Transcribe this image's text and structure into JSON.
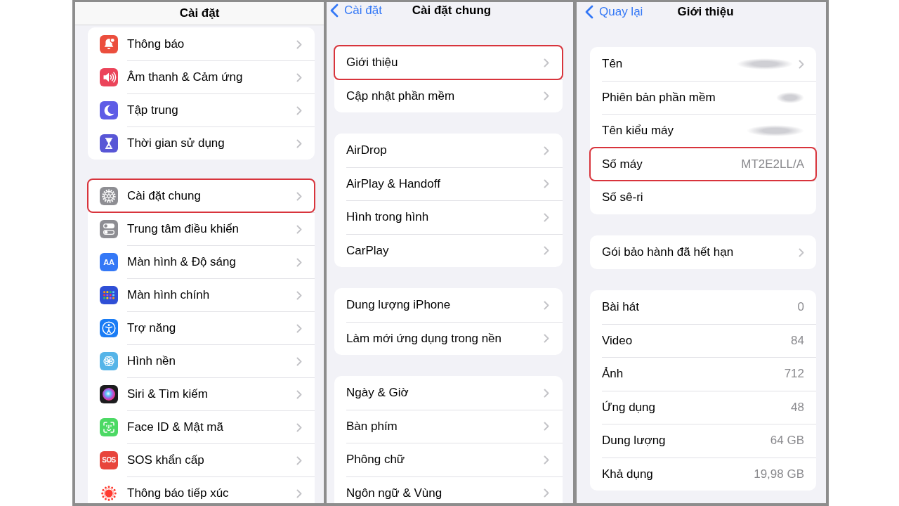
{
  "settings_screen": {
    "title": "Cài đặt",
    "scrolled": true,
    "groups": [
      {
        "rows": [
          {
            "label": "Thông báo",
            "color": "#eb4e3d",
            "chevron": true,
            "highlighted": false
          },
          {
            "label": "Âm thanh & Cảm ứng",
            "color": "#eb445a",
            "chevron": true,
            "highlighted": false
          },
          {
            "label": "Tập trung",
            "color": "#5e5ce6",
            "chevron": true,
            "highlighted": false
          },
          {
            "label": "Thời gian sử dụng",
            "color": "#5856d6",
            "chevron": true,
            "highlighted": false
          }
        ]
      },
      {
        "rows": [
          {
            "label": "Cài đặt chung",
            "color": "#8e8e93",
            "chevron": true,
            "highlighted": true
          },
          {
            "label": "Trung tâm điều khiển",
            "color": "#8e8e93",
            "chevron": true,
            "highlighted": false
          },
          {
            "label": "Màn hình & Độ sáng",
            "color": "#3478f6",
            "icon_text": "AA",
            "chevron": true,
            "highlighted": false
          },
          {
            "label": "Màn hình chính",
            "color": "#2f4fd6",
            "chevron": true,
            "highlighted": false
          },
          {
            "label": "Trợ năng",
            "color": "#1a7cf5",
            "chevron": true,
            "highlighted": false
          },
          {
            "label": "Hình nền",
            "color": "#55b4e8",
            "chevron": true,
            "highlighted": false
          },
          {
            "label": "Siri & Tìm kiếm",
            "color": "#1c1c1e",
            "chevron": true,
            "highlighted": false
          },
          {
            "label": "Face ID & Mật mã",
            "color": "#4cd964",
            "chevron": true,
            "highlighted": false
          },
          {
            "label": "SOS khẩn cấp",
            "color": "#e8453c",
            "icon_text": "SOS",
            "chevron": true,
            "highlighted": false
          },
          {
            "label": "Thông báo tiếp xúc",
            "color": "#ffffff",
            "chevron": true,
            "highlighted": false
          }
        ]
      }
    ]
  },
  "general_screen": {
    "back_button": "Cài đặt",
    "title": "Cài đặt chung",
    "scrolled": false,
    "groups": [
      {
        "rows": [
          {
            "label": "Giới thiệu",
            "chevron": true,
            "highlighted": true
          },
          {
            "label": "Cập nhật phần mềm",
            "chevron": true,
            "highlighted": false
          }
        ]
      },
      {
        "rows": [
          {
            "label": "AirDrop",
            "chevron": true,
            "highlighted": false
          },
          {
            "label": "AirPlay & Handoff",
            "chevron": true,
            "highlighted": false
          },
          {
            "label": "Hình trong hình",
            "chevron": true,
            "highlighted": false
          },
          {
            "label": "CarPlay",
            "chevron": true,
            "highlighted": false
          }
        ]
      },
      {
        "rows": [
          {
            "label": "Dung lượng iPhone",
            "chevron": true,
            "highlighted": false
          },
          {
            "label": "Làm mới ứng dụng trong nền",
            "chevron": true,
            "highlighted": false
          }
        ]
      },
      {
        "rows": [
          {
            "label": "Ngày & Giờ",
            "chevron": true,
            "highlighted": false
          },
          {
            "label": "Bàn phím",
            "chevron": true,
            "highlighted": false
          },
          {
            "label": "Phông chữ",
            "chevron": true,
            "highlighted": false
          },
          {
            "label": "Ngôn ngữ & Vùng",
            "chevron": true,
            "highlighted": false
          }
        ]
      }
    ]
  },
  "about_screen": {
    "back_button": "Quay lại",
    "title": "Giới thiệu",
    "scrolled": false,
    "groups": [
      {
        "rows": [
          {
            "label": "Tên",
            "redacted": true,
            "chevron": true,
            "highlighted": false
          },
          {
            "label": "Phiên bản phần mềm",
            "redacted": true,
            "chevron": false,
            "highlighted": false
          },
          {
            "label": "Tên kiểu máy",
            "redacted": true,
            "chevron": false,
            "highlighted": false
          },
          {
            "label": "Số máy",
            "value": "MT2E2LL/A",
            "redacted": false,
            "chevron": false,
            "highlighted": true
          },
          {
            "label": "Số sê-ri",
            "redacted": false,
            "chevron": false,
            "highlighted": false
          }
        ]
      },
      {
        "rows": [
          {
            "label": "Gói bảo hành đã hết hạn",
            "redacted": false,
            "chevron": true,
            "highlighted": false
          }
        ]
      },
      {
        "rows": [
          {
            "label": "Bài hát",
            "value": "0",
            "redacted": false,
            "chevron": false,
            "highlighted": false
          },
          {
            "label": "Video",
            "value": "84",
            "redacted": false,
            "chevron": false,
            "highlighted": false
          },
          {
            "label": "Ảnh",
            "value": "712",
            "redacted": false,
            "chevron": false,
            "highlighted": false
          },
          {
            "label": "Ứng dụng",
            "value": "48",
            "redacted": false,
            "chevron": false,
            "highlighted": false
          },
          {
            "label": "Dung lượng",
            "value": "64 GB",
            "redacted": false,
            "chevron": false,
            "highlighted": false
          },
          {
            "label": "Khả dụng",
            "value": "19,98 GB",
            "redacted": false,
            "chevron": false,
            "highlighted": false
          }
        ]
      }
    ]
  }
}
